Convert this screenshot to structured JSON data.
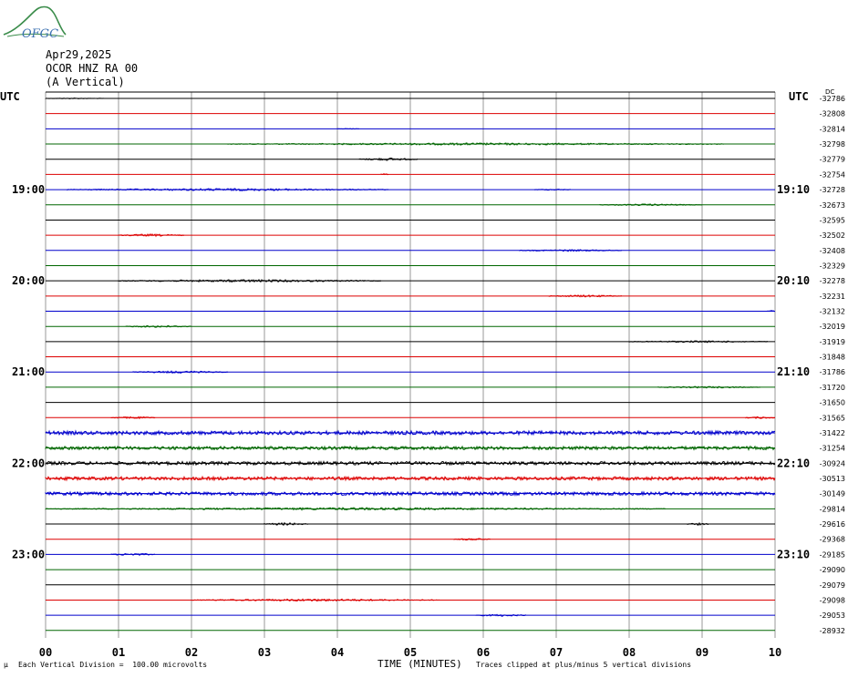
{
  "header": {
    "date": "Apr29,2025",
    "station": "OCOR HNZ RA 00",
    "component": "(A Vertical)",
    "utc_left": "UTC",
    "utc_right": "UTC",
    "dc_label": "DC"
  },
  "logo": {
    "text": "OFGC",
    "colors": {
      "text": "#3a6fb0",
      "hill": "#3a8c4a"
    }
  },
  "footer": {
    "division_note": "Each Vertical Division =  100.00 microvolts",
    "mu": "μ",
    "clip_note": "Traces clipped at plus/minus 5 vertical divisions"
  },
  "chart_data": {
    "type": "line",
    "xlabel": "TIME (MINUTES)",
    "x_ticks": [
      "00",
      "01",
      "02",
      "03",
      "04",
      "05",
      "06",
      "07",
      "08",
      "09",
      "10"
    ],
    "xlim": [
      0,
      10
    ],
    "colors": [
      "#000000",
      "#dd0000",
      "#0000cc",
      "#006600"
    ],
    "left_time_labels": [
      {
        "row": 6,
        "text": "19:00"
      },
      {
        "row": 12,
        "text": "20:00"
      },
      {
        "row": 18,
        "text": "21:00"
      },
      {
        "row": 24,
        "text": "22:00"
      },
      {
        "row": 30,
        "text": "23:00"
      }
    ],
    "right_time_labels": [
      {
        "row": 6,
        "text": "19:10"
      },
      {
        "row": 12,
        "text": "20:10"
      },
      {
        "row": 18,
        "text": "21:10"
      },
      {
        "row": 24,
        "text": "22:10"
      },
      {
        "row": 30,
        "text": "23:10"
      }
    ],
    "dc_offsets": [
      "-32786",
      "-32808",
      "-32814",
      "-32798",
      "-32779",
      "-32754",
      "-32728",
      "-32673",
      "-32595",
      "-32502",
      "-32408",
      "-32329",
      "-32278",
      "-32231",
      "-32132",
      "-32019",
      "-31919",
      "-31848",
      "-31786",
      "-31720",
      "-31650",
      "-31565",
      "-31422",
      "-31254",
      "-30924",
      "-30513",
      "-30149",
      "-29814",
      "-29616",
      "-29368",
      "-29185",
      "-29090",
      "-29079",
      "-29098",
      "-29053",
      "-28932"
    ],
    "noise_bursts": [
      {
        "row": 0,
        "start": 0.0,
        "end": 0.8,
        "amp": 0.5
      },
      {
        "row": 2,
        "start": 4.0,
        "end": 4.3,
        "amp": 0.5
      },
      {
        "row": 3,
        "start": 2.5,
        "end": 9.3,
        "amp": 1.2
      },
      {
        "row": 4,
        "start": 4.3,
        "end": 5.1,
        "amp": 1.5
      },
      {
        "row": 5,
        "start": 4.6,
        "end": 4.7,
        "amp": 1.0
      },
      {
        "row": 6,
        "start": 0.3,
        "end": 4.7,
        "amp": 1.3
      },
      {
        "row": 6,
        "start": 6.7,
        "end": 7.2,
        "amp": 0.8
      },
      {
        "row": 7,
        "start": 7.6,
        "end": 9.0,
        "amp": 1.0
      },
      {
        "row": 9,
        "start": 1.0,
        "end": 1.9,
        "amp": 1.3
      },
      {
        "row": 10,
        "start": 6.5,
        "end": 7.9,
        "amp": 1.1
      },
      {
        "row": 12,
        "start": 1.0,
        "end": 4.6,
        "amp": 1.4
      },
      {
        "row": 13,
        "start": 6.9,
        "end": 7.9,
        "amp": 1.2
      },
      {
        "row": 14,
        "start": 9.9,
        "end": 10.0,
        "amp": 1.0
      },
      {
        "row": 15,
        "start": 1.1,
        "end": 2.0,
        "amp": 1.2
      },
      {
        "row": 16,
        "start": 8.0,
        "end": 9.9,
        "amp": 1.0
      },
      {
        "row": 18,
        "start": 1.2,
        "end": 2.5,
        "amp": 1.3
      },
      {
        "row": 19,
        "start": 8.4,
        "end": 9.8,
        "amp": 1.0
      },
      {
        "row": 21,
        "start": 0.9,
        "end": 1.5,
        "amp": 1.2
      },
      {
        "row": 21,
        "start": 9.6,
        "end": 10.0,
        "amp": 1.2
      },
      {
        "row": 22,
        "start": 0.0,
        "end": 10.0,
        "amp": 2.0
      },
      {
        "row": 23,
        "start": 0.0,
        "end": 10.0,
        "amp": 1.8
      },
      {
        "row": 24,
        "start": 0.0,
        "end": 10.0,
        "amp": 1.8
      },
      {
        "row": 25,
        "start": 0.0,
        "end": 10.0,
        "amp": 1.8
      },
      {
        "row": 26,
        "start": 0.0,
        "end": 10.0,
        "amp": 1.8
      },
      {
        "row": 27,
        "start": 0.0,
        "end": 8.5,
        "amp": 1.4
      },
      {
        "row": 28,
        "start": 3.0,
        "end": 3.6,
        "amp": 1.5
      },
      {
        "row": 28,
        "start": 8.8,
        "end": 9.1,
        "amp": 1.2
      },
      {
        "row": 29,
        "start": 5.6,
        "end": 6.1,
        "amp": 1.2
      },
      {
        "row": 30,
        "start": 0.9,
        "end": 1.5,
        "amp": 1.4
      },
      {
        "row": 33,
        "start": 2.0,
        "end": 5.4,
        "amp": 1.3
      },
      {
        "row": 34,
        "start": 5.9,
        "end": 6.6,
        "amp": 1.2
      }
    ]
  }
}
